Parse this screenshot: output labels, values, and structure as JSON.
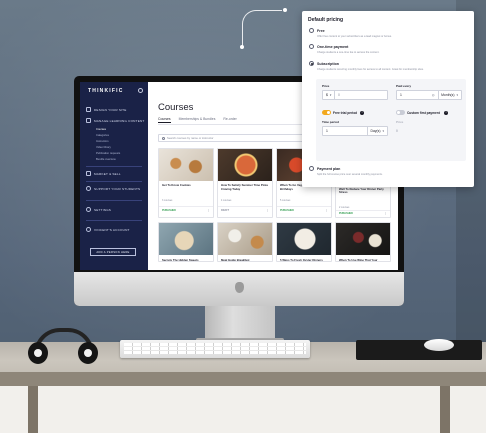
{
  "brand": "THINKIFIC",
  "sidebar": {
    "items": [
      {
        "label": "DESIGN YOUR SITE"
      },
      {
        "label": "MANAGE LEARNING CONTENT"
      },
      {
        "label": "MARKET & SELL"
      },
      {
        "label": "SUPPORT YOUR STUDENTS"
      },
      {
        "label": "SETTINGS"
      },
      {
        "label": "VINCENT'S ACCOUNT"
      }
    ],
    "sub_items": [
      "Courses",
      "Categories",
      "Instructors",
      "Video library",
      "Publication requests",
      "Bundle overview"
    ],
    "add_people": "ADD A PERSON HERE"
  },
  "main": {
    "title": "Courses",
    "tabs": [
      "Courses",
      "Memberships & Bundles",
      "Re-order"
    ],
    "search_placeholder": "Search courses by name or instructor",
    "cards": [
      {
        "title": "Get To Know Cookies",
        "meta": "3 courses",
        "status": "PUBLISHED"
      },
      {
        "title": "How To Satisfy Summer Time Pizza Craving Today",
        "meta": "4 courses",
        "status": "DRAFT"
      },
      {
        "title": "When To Go Vegetarian On Your Birthdays",
        "meta": "5 courses",
        "status": "PUBLISHED"
      },
      {
        "title": "Why Do Kale Bread Recipes Work So Well To Reduce Your Dinner Party Stress",
        "meta": "2 courses",
        "status": "PUBLISHED"
      }
    ],
    "row2_titles": [
      "Secrets The Hidden Sweets",
      "Meal Guide Breakfast",
      "5 Ways To Fresh Oyster Dinners",
      "When To Use Wine That Your"
    ]
  },
  "pricing": {
    "title": "Default pricing",
    "options": [
      {
        "label": "Free",
        "desc": "Offer free content to your subscribers as a lead magnet or bonus."
      },
      {
        "label": "One-time payment",
        "desc": "Charge students a one-time fee to access the content."
      },
      {
        "label": "Subscription",
        "desc": "Charge students recurring monthly fees for access to all content. Great for membership sites."
      },
      {
        "label": "Payment plan",
        "desc": "Split the full course price over several monthly payments."
      }
    ],
    "selected": "Subscription",
    "price_label": "Price",
    "currency": "$",
    "price_value": "0",
    "paid_every_label": "Paid every",
    "paid_every_value": "1",
    "interval": "Month(s)",
    "free_trial_label": "Free trial period",
    "free_trial_on": true,
    "custom_first_label": "Custom first payment",
    "custom_first_on": false,
    "time_period_label": "Time period",
    "time_period_value": "1",
    "time_period_unit": "Day(s)",
    "price2_label": "Price",
    "price2_value": "0"
  },
  "colors": {
    "sidebar": "#1a2247",
    "toggle_on": "#f2a81d",
    "published": "#2e9b4e"
  }
}
